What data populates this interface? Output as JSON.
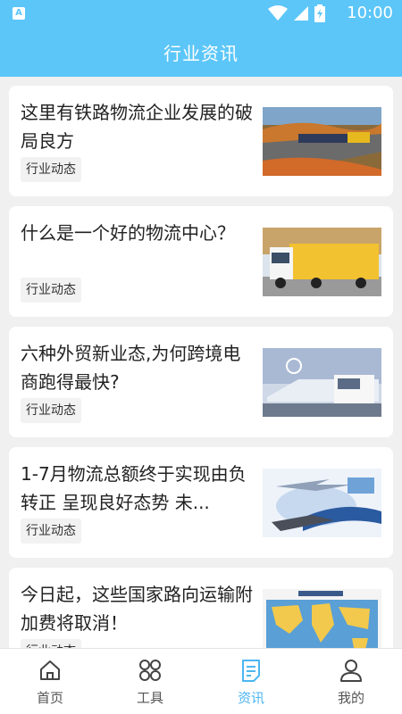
{
  "status_bar": {
    "app_badge": "A",
    "time": "10:00",
    "icons": [
      "wifi-icon",
      "signal-icon",
      "battery-icon"
    ]
  },
  "header": {
    "title": "行业资讯"
  },
  "articles": [
    {
      "title": "这里有铁路物流企业发展的破局良方",
      "tag": "行业动态",
      "image": "train-thumbnail"
    },
    {
      "title": "什么是一个好的物流中心？",
      "tag": "行业动态",
      "image": "truck-thumbnail"
    },
    {
      "title": "六种外贸新业态,为何跨境电商跑得最快?",
      "tag": "行业动态",
      "image": "truck-fleet-thumbnail"
    },
    {
      "title": "1-7月物流总额终于实现由负转正 呈现良好态势 未...",
      "tag": "行业动态",
      "image": "transport-collage-thumbnail"
    },
    {
      "title": "今日起，这些国家路向运输附加费将取消！",
      "tag": "行业动态",
      "image": "world-map-thumbnail"
    }
  ],
  "tabs": [
    {
      "label": "首页",
      "icon": "home-icon",
      "active": false
    },
    {
      "label": "工具",
      "icon": "grid-icon",
      "active": false
    },
    {
      "label": "资讯",
      "icon": "news-icon",
      "active": true
    },
    {
      "label": "我的",
      "icon": "profile-icon",
      "active": false
    }
  ],
  "colors": {
    "primary": "#5cc6f8",
    "tab_active": "#4cb6f0",
    "background": "#f0f0f0"
  }
}
